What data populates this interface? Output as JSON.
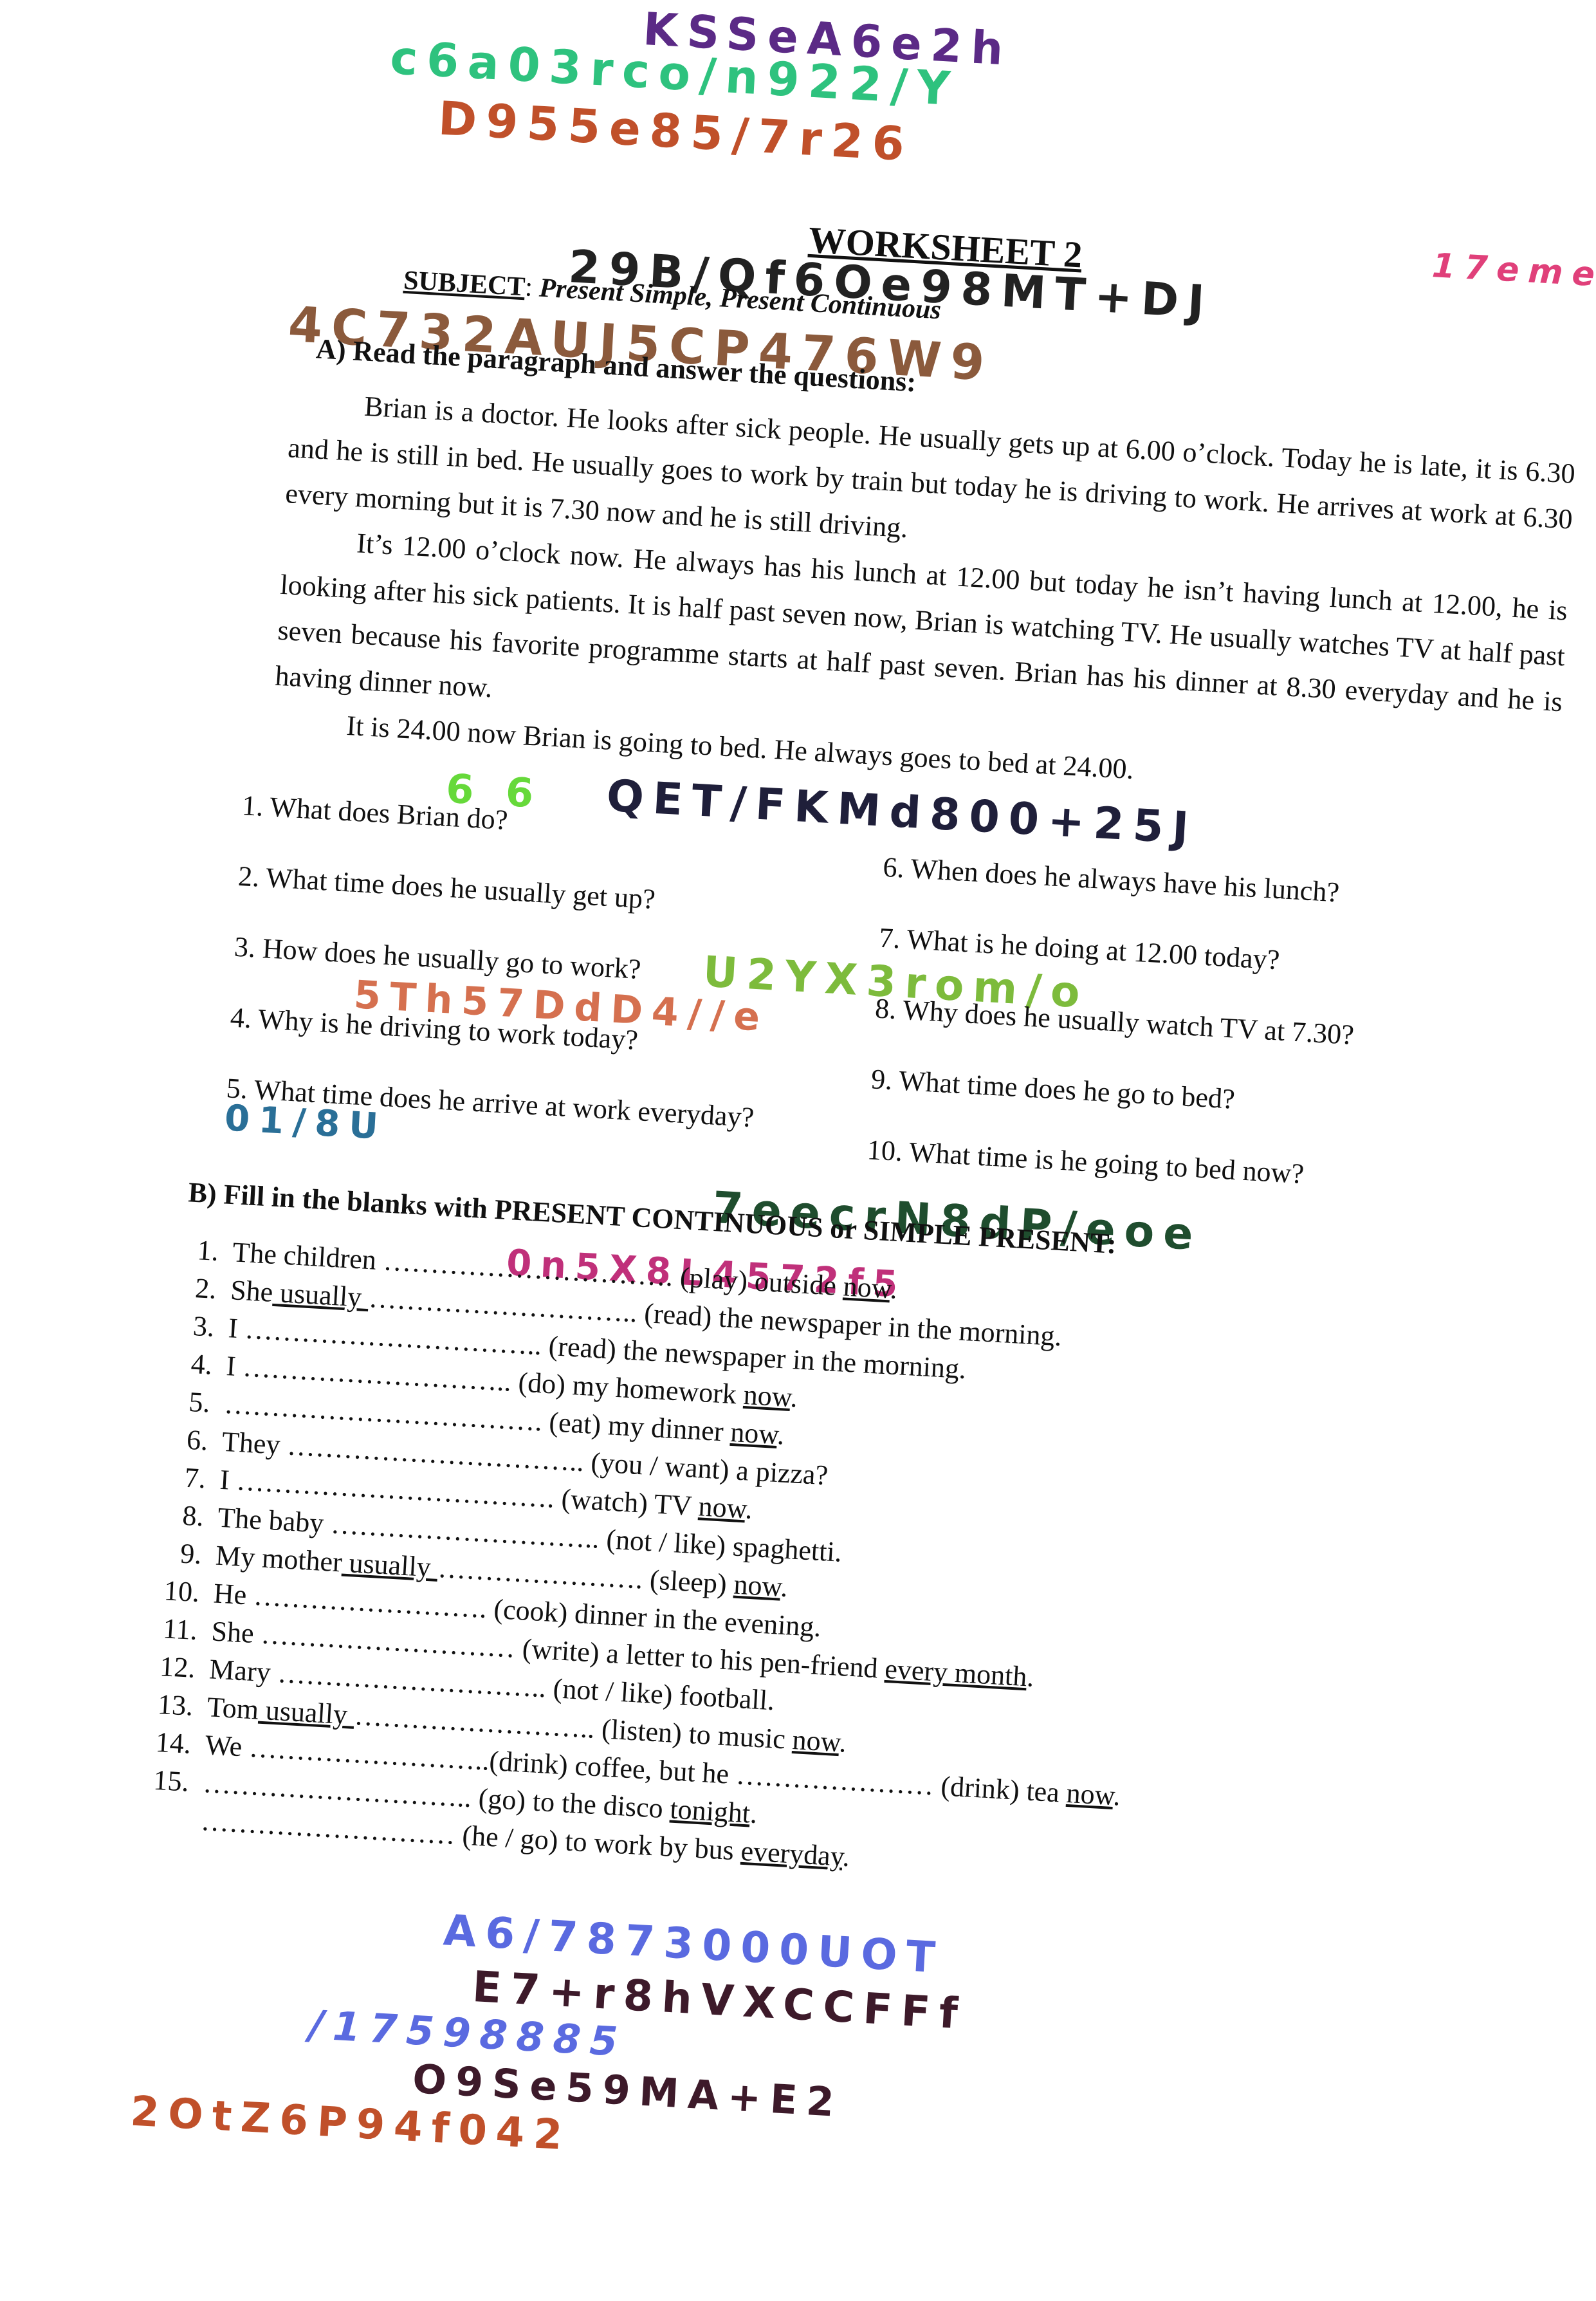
{
  "colors": {
    "purple": "#5b2a86",
    "green": "#2ec27e",
    "orange": "#c0502a",
    "black": "#222222",
    "pink": "#e0407a",
    "brown": "#8b5a3c",
    "lime": "#66d93a",
    "navy": "#1f1f3a",
    "leaf": "#7dbb3c",
    "salmon": "#d5704f",
    "teal": "#2a6f97",
    "darkgreen": "#1f4d2e",
    "magenta": "#c0307a",
    "blue": "#5a6ae0",
    "plum": "#3d1a2a"
  },
  "worksheet": {
    "title": "WORKSHEET 2",
    "subject_label": "SUBJECT",
    "subject_sep": ": ",
    "subject_value": "Present Simple, Present Continuous",
    "section_a": "A) Read the paragraph and answer the questions:",
    "paragraphs": [
      "Brian is a doctor. He looks after sick people. He usually gets up at 6.00 o’clock. Today he is late, it is 6.30 and he is still in bed. He usually goes to work by train but today he is driving to work. He arrives at work at 6.30 every morning but it is 7.30 now and he is still driving.",
      "It’s 12.00 o’clock now. He always has his lunch at 12.00 but today he isn’t having lunch at 12.00, he is looking after his sick patients. It is half past seven now, Brian is watching TV. He usually watches TV at half past seven because his favorite programme starts at half past seven. Brian has his dinner at 8.30 everyday and he is having dinner now.",
      "It is 24.00 now Brian is going to bed. He always goes to bed at 24.00."
    ],
    "questions": [
      "1. What does Brian do?",
      "2. What time does he usually get up?",
      "3. How does he usually go to work?",
      "4. Why is he driving to work today?",
      "5. What time does he arrive at work everyday?",
      "6. When does he always have his lunch?",
      "7. What is he doing at 12.00 today?",
      "8. Why does he usually watch TV at 7.30?",
      "9. What time does he go to bed?",
      "10. What time is he going to bed now?"
    ],
    "section_b": "B)  Fill in the blanks with PRESENT CONTINUOUS or SIMPLE PRESENT:",
    "blanks": [
      {
        "num": "1.",
        "a": "The children …………………………. (play) outside ",
        "u": "now",
        "b": "."
      },
      {
        "num": "2.",
        "a": "She",
        "u0": " usually ",
        "a2": "……………………….. (read) the newspaper in the morning.",
        "u": "",
        "b": ""
      },
      {
        "num": "3.",
        "a": "I ………………………….. (read) the newspaper in the morning.",
        "u": "",
        "b": ""
      },
      {
        "num": "4.",
        "a": "I ……………………….. (do) my homework ",
        "u": "now",
        "b": "."
      },
      {
        "num": "5.",
        "a": "……………………………. (eat) my dinner ",
        "u": "now",
        "b": "."
      },
      {
        "num": "6.",
        "a": "They ………………………….. (you / want) a pizza?",
        "u": "",
        "b": ""
      },
      {
        "num": "7.",
        "a": "I ……………………………. (watch) TV ",
        "u": "now",
        "b": "."
      },
      {
        "num": "8.",
        "a": "The baby ……………………….. (not / like) spaghetti.",
        "u": "",
        "b": ""
      },
      {
        "num": "9.",
        "a": "My mother",
        "u0": " usually ",
        "a2": "…………………. (sleep) ",
        "u": "now",
        "b": "."
      },
      {
        "num": "10.",
        "a": "He ……………………. (cook) dinner in the evening.",
        "u": "",
        "b": ""
      },
      {
        "num": "11.",
        "a": "She ……………………… (write) a letter to his pen-friend ",
        "u": "every month",
        "b": "."
      },
      {
        "num": "12.",
        "a": "Mary ……………………….. (not / like) football.",
        "u": "",
        "b": ""
      },
      {
        "num": "13.",
        "a": "Tom",
        "u0": " usually ",
        "a2": "…………………….. (listen) to music ",
        "u": "now",
        "b": "."
      },
      {
        "num": "14.",
        "a": "We ……………………..(drink) coffee, but he ………………… (drink) tea ",
        "u": "now",
        "b": "."
      },
      {
        "num": "15.",
        "a": "……………………….. (go) to the disco ",
        "u": "tonight",
        "b": "."
      },
      {
        "num": "",
        "a": "……………………… (he / go) to work by bus ",
        "u": "everyday",
        "b": "."
      }
    ]
  },
  "scribbles": [
    {
      "text": "KSSeA6e2h",
      "color": "#5b2a86"
    },
    {
      "text": "c6a03rco/n922/Y",
      "color": "#2ec27e"
    },
    {
      "text": "D955e85/7r26",
      "color": "#c0502a"
    },
    {
      "text": "29B/Qf6Oe98MT+DJ",
      "color": "#222222"
    },
    {
      "text": "17eme",
      "color": "#e0407a"
    },
    {
      "text": "4C732AUJ5CP476W9",
      "color": "#8b5a3c"
    },
    {
      "text": "6 6",
      "color": "#66d93a"
    },
    {
      "text": "QET/FKMd800+25J",
      "color": "#1f1f3a"
    },
    {
      "text": "U2YX3rom/o",
      "color": "#7dbb3c"
    },
    {
      "text": "5Th57DdD4//e",
      "color": "#d5704f"
    },
    {
      "text": "01/8U",
      "color": "#2a6f97"
    },
    {
      "text": "7eecrN8dP/eoe",
      "color": "#1f4d2e"
    },
    {
      "text": "0n5X8L4572f5",
      "color": "#c0307a"
    },
    {
      "text": "A6/7873000UOT",
      "color": "#5a6ae0"
    },
    {
      "text": "E7+r8hVXCCFFf",
      "color": "#3d1a2a"
    },
    {
      "text": "/17598885",
      "color": "#5a6ae0"
    },
    {
      "text": "O9Se59MA+E2",
      "color": "#3d1a2a"
    },
    {
      "text": "2OtZ6P94f042",
      "color": "#c0502a"
    }
  ]
}
